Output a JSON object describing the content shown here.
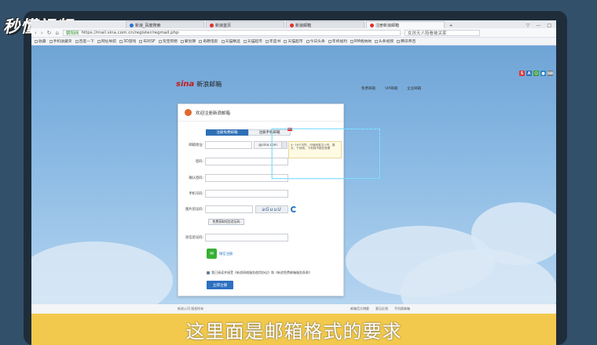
{
  "watermark": {
    "logo": "秒懂视频"
  },
  "browser": {
    "tabs": [
      {
        "label": "新浪_百度搜索",
        "active": false
      },
      {
        "label": "新浪首页",
        "active": false
      },
      {
        "label": "新浪邮箱",
        "active": false
      },
      {
        "label": "注册新浪邮箱",
        "active": true
      }
    ],
    "new_tab": "+",
    "window_controls": [
      "▽",
      "—",
      "□"
    ],
    "address": {
      "site_label": "朝阳网",
      "url": "https://mail.sina.com.cn/register/regmail.php",
      "search_placeholder": "女孩无人陪看被关家"
    },
    "bookmarks": [
      "收藏",
      "手机收藏夹",
      "百度一下",
      "网址导航",
      "3D游戏",
      "布鸡SF",
      "淘宝购物",
      "聚划算",
      "奇葩电影",
      "天猫精选",
      "天猫超市",
      "年度书",
      "天猫超市",
      "今日头条",
      "年终福利",
      "RM格纳纳",
      "头条视频",
      "腾讯帝百"
    ]
  },
  "page": {
    "brand_mark": "sina",
    "brand_name": "新浪邮箱",
    "top_links": [
      "免费邮箱",
      "VIP邮箱",
      "企业邮箱"
    ],
    "panel_title": "欢迎注册新浪邮箱",
    "tabs": [
      "注册免费邮箱",
      "注册手机邮箱"
    ],
    "fields": {
      "email_label": "邮箱地址:",
      "email_suffix": "@sina.com",
      "password_label": "密码:",
      "confirm_label": "确认密码:",
      "phone_label": "手机号码:",
      "captcha_label": "图片验证码:",
      "captcha_text": "aGuuU",
      "get_code_button": "免费获取短信验证码",
      "sms_label": "短信验证码:"
    },
    "tooltip": "4~16个字符，可使用英文小写、数字、下划线，下划线不能在首尾",
    "wechat_label": "微信注册",
    "agree_text": "我已阅读并接受《新浪网络服务使用协议》和《新浪免费邮箱服务条款》",
    "submit_label": "立即注册",
    "footer_left": "新浪公司 版权所有",
    "footer_right": [
      "邮箱官方博客",
      "意见反馈",
      "手机版邮箱"
    ]
  },
  "caption": "这里面是邮箱格式的要求"
}
